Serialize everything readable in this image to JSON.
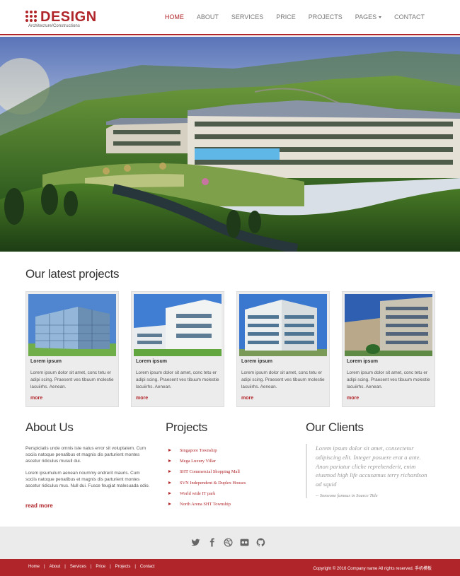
{
  "logo": {
    "name": "DESIGN",
    "tagline": "Architecture/Constructions"
  },
  "nav": {
    "items": [
      "HOME",
      "ABOUT",
      "SERVICES",
      "PRICE",
      "PROJECTS",
      "PAGES",
      "CONTACT"
    ],
    "active": "HOME"
  },
  "projects": {
    "title": "Our latest projects",
    "cards": [
      {
        "title": "Lorem ipsum",
        "text": "Lorem ipsum dolor sit amet, conc tetu er adipi scing. Praesent ves tibuum molestie lacuiirhs. Aenean.",
        "more": "more"
      },
      {
        "title": "Lorem ipsum",
        "text": "Lorem ipsum dolor sit amet, conc tetu er adipi scing. Praesent ves tibuum molestie lacuiirhs. Aenean.",
        "more": "more"
      },
      {
        "title": "Lorem ipsum",
        "text": "Lorem ipsum dolor sit amet, conc tetu er adipi scing. Praesent ves tibuum molestie lacuiirhs. Aenean.",
        "more": "more"
      },
      {
        "title": "Lorem ipsum",
        "text": "Lorem ipsum dolor sit amet, conc tetu er adipi scing. Praesent ves tibuum molestie lacuiirhs. Aenean.",
        "more": "more"
      }
    ]
  },
  "about": {
    "title": "About Us",
    "p1": "Perspiciatis unde omnis iste natus error sit voluptatem. Cum sociis natoque penatibus et magnis dis parturient montes ascetur ridiculus musull dui.",
    "p2": "Lorem ipsumulum aenean noummy endrerit mauris. Cum sociis natoque penatibus et magnis dis parturient montes ascetur ridiculus mus. Null dui. Fusce feugiat malesuada odio.",
    "read_more": "read more"
  },
  "projects_list": {
    "title": "Projects",
    "items": [
      "Singapore Township",
      "Mega Luxury Villar",
      "SHT Commercial Shopping Mall",
      "SVN Independent & Duplex Houses",
      "World wide IT park",
      "North Arena SHT Township"
    ]
  },
  "clients": {
    "title": "Our Clients",
    "quote": "Lorem ipsum dolor sit amet, consectetur adipiscing elit. Integer posuere erat a ante. Anon pariatur cliche reprehenderit, enim eiusmod high life accusamus terry richardson ad squid",
    "cite": "-- Someone famous in Source Title"
  },
  "social": [
    "twitter-icon",
    "facebook-icon",
    "dribbble-icon",
    "flickr-icon",
    "github-icon"
  ],
  "footer": {
    "links": [
      "Home",
      "About",
      "Services",
      "Price",
      "Projects",
      "Contact"
    ],
    "copyright": "Copyright © 2016 Company name All rights reserved. 手机模板"
  },
  "colors": {
    "accent": "#b0252a",
    "social_bg": "#ebebeb"
  }
}
